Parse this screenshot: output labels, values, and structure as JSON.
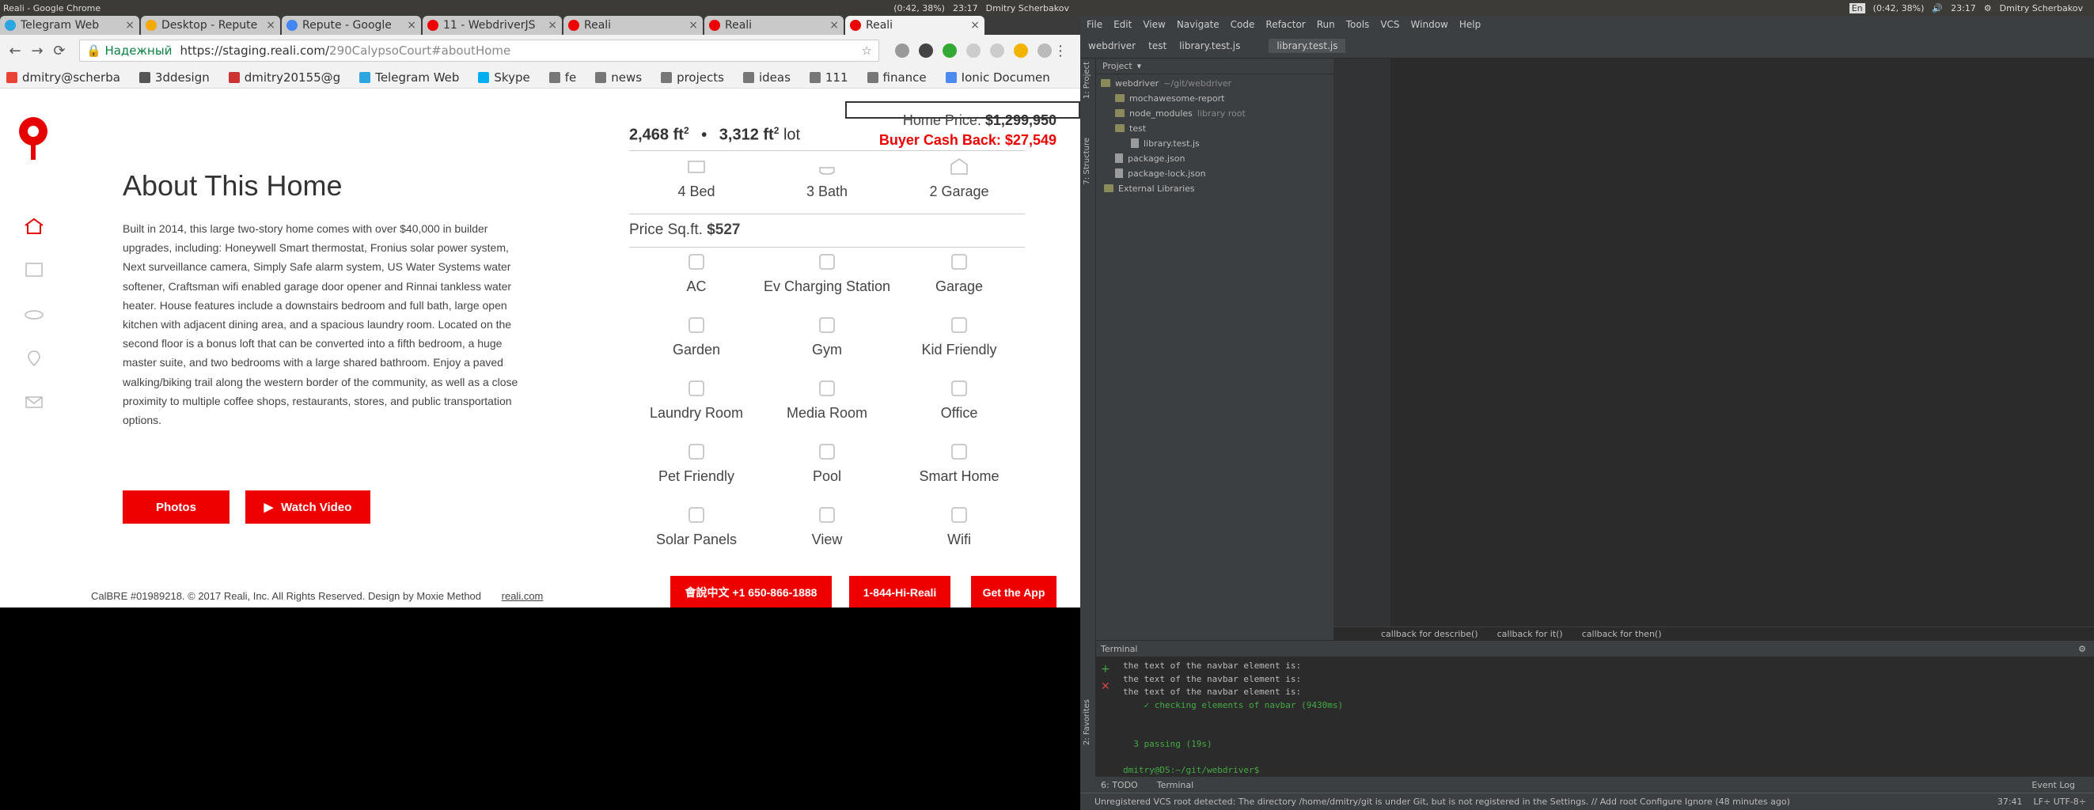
{
  "system": {
    "left_title": "Reali - Google Chrome",
    "left_status": "(0:42, 38%)",
    "left_time": "23:17",
    "left_user": "Dmitry Scherbakov",
    "right_lang": "En",
    "right_battery": "(0:42, 38%)",
    "right_time": "23:17",
    "right_user": "Dmitry Scherbakov"
  },
  "chrome": {
    "tabs": [
      {
        "label": "Telegram Web",
        "color": "#2ca5e0"
      },
      {
        "label": "Desktop - Repute",
        "color": "#f2a900"
      },
      {
        "label": "Repute - Google",
        "color": "#4285f4"
      },
      {
        "label": "11 - WebdriverJS",
        "color": "#e00"
      },
      {
        "label": "Reali",
        "color": "#e00"
      },
      {
        "label": "Reali",
        "color": "#e00"
      },
      {
        "label": "Reali",
        "color": "#e00"
      }
    ],
    "secure_label": "Надежный",
    "url_host": "https://staging.reali.com/",
    "url_path": "290CalypsoCourt#aboutHome",
    "bookmarks": [
      "dmitry@scherba",
      "3ddesign",
      "dmitry20155@g",
      "Telegram Web",
      "Skype",
      "fe",
      "news",
      "projects",
      "ideas",
      "111",
      "finance",
      "Ionic Documen"
    ]
  },
  "page": {
    "heading": "About This Home",
    "description": "Built in 2014, this large two-story home comes with over $40,000 in builder upgrades, including: Honeywell Smart thermostat, Fronius solar power system, Next surveillance camera, Simply Safe alarm system, US Water Systems water softener, Craftsman wifi enabled garage door opener and Rinnai tankless water heater. House features include a downstairs bedroom and full bath, large open kitchen with adjacent dining area, and a spacious laundry room. Located on the second floor is a bonus loft that can be converted into a fifth bedroom, a huge master suite, and two bedrooms with a large shared bathroom. Enjoy a paved walking/biking trail along the western border of the community, as well as a close proximity to multiple coffee shops, restaurants, stores, and public transportation options.",
    "photos_label": "Photos",
    "video_label": "Watch Video",
    "sqft": "2,468 ft",
    "lot": "3,312 ft",
    "lot_suffix": "lot",
    "sup": "2",
    "dot": "•",
    "home_price_label": "Home Price:",
    "home_price": "$1,299,950",
    "cashback_label": "Buyer Cash Back:",
    "cashback": "$27,549",
    "beds": "4 Bed",
    "baths": "3 Bath",
    "garage": "2 Garage",
    "psqft_label": "Price Sq.ft.",
    "psqft": "$527",
    "features": [
      "AC",
      "Ev Charging Station",
      "Garage",
      "Garden",
      "Gym",
      "Kid Friendly",
      "Laundry Room",
      "Media Room",
      "Office",
      "Pet Friendly",
      "Pool",
      "Smart Home",
      "Solar Panels",
      "View",
      "Wifi"
    ],
    "footer_text": "CalBRE #01989218. © 2017 Reali, Inc. All Rights Reserved. Design by Moxie Method",
    "footer_link": "reali.com",
    "phone_cn": "會說中文 +1 650-866-1888",
    "phone_main": "1-844-Hi-Reali",
    "get_app": "Get the App",
    "accent": "#e60000"
  },
  "ide": {
    "menu": [
      "File",
      "Edit",
      "View",
      "Navigate",
      "Code",
      "Refactor",
      "Run",
      "Tools",
      "VCS",
      "Window",
      "Help"
    ],
    "nav": [
      "webdriver",
      "test",
      "library.test.js"
    ],
    "project_label": "Project",
    "tree": [
      {
        "label": "webdriver",
        "extra": "~/git/webdriver"
      },
      {
        "label": "mochawesome-report",
        "extra": ""
      },
      {
        "label": "node_modules",
        "extra": "library root"
      },
      {
        "label": "test",
        "extra": ""
      },
      {
        "label": "library.test.js",
        "extra": ""
      },
      {
        "label": "package.json",
        "extra": ""
      },
      {
        "label": "package-lock.json",
        "extra": ""
      },
      {
        "label": "External Libraries",
        "extra": ""
      }
    ],
    "editor_tab": "library.test.js",
    "breadcrumbs": [
      "callback for describe()",
      "callback for it()",
      "callback for then()"
    ],
    "terminal_label": "Terminal",
    "terminal_lines": [
      "the text of the navbar element is:",
      "the text of the navbar element is:",
      "the text of the navbar element is:",
      "    ✓ checking elements of navbar (9430ms)",
      "",
      "",
      "  3 passing (19s)",
      "",
      "dmitry@DS:~/git/webdriver$"
    ],
    "bottom_tabs": [
      "6: TODO",
      "Terminal"
    ],
    "event_log": "Event Log",
    "status_text": "Unregistered VCS root detected: The directory /home/dmitry/git is under Git, but is not registered in the Settings. // Add root  Configure  Ignore (48 minutes ago)",
    "status_pos": "37:41",
    "status_enc": "LF÷  UTF-8÷",
    "side_labels": [
      "1: Project",
      "7: Structure",
      "2: Favorites"
    ]
  }
}
